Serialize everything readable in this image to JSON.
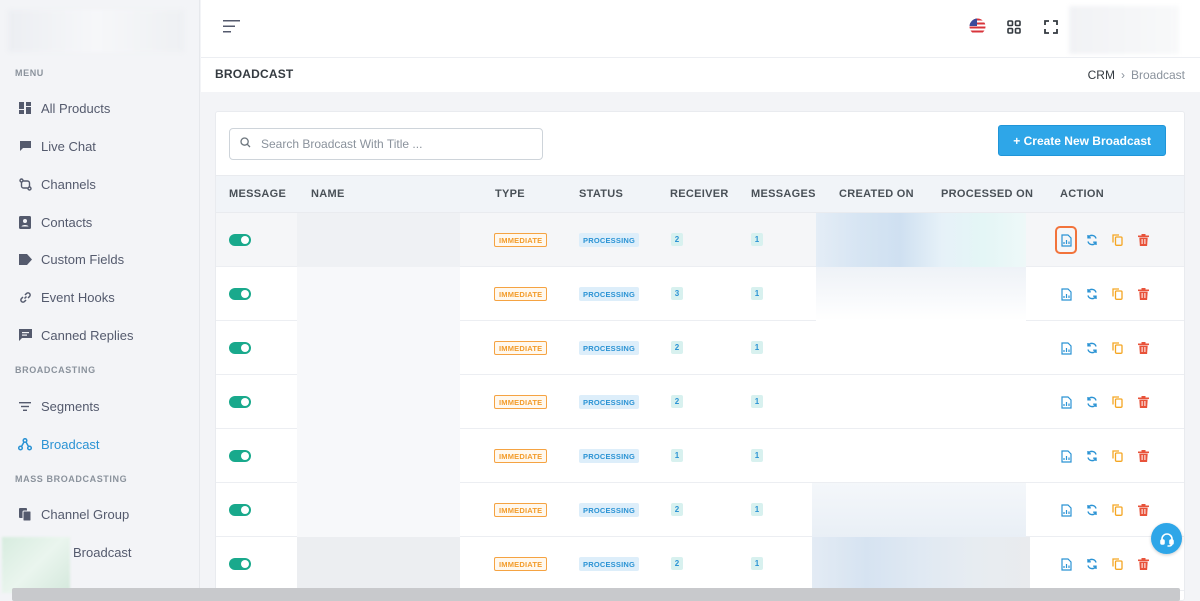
{
  "sidebar": {
    "sections": [
      {
        "title": "MENU"
      },
      {
        "title": "BROADCASTING"
      },
      {
        "title": "MASS BROADCASTING"
      }
    ],
    "items": [
      {
        "label": "All Products",
        "icon": "grid-icon"
      },
      {
        "label": "Live Chat",
        "icon": "chat-icon"
      },
      {
        "label": "Channels",
        "icon": "channels-icon"
      },
      {
        "label": "Contacts",
        "icon": "contact-card-icon"
      },
      {
        "label": "Custom Fields",
        "icon": "tag-icon"
      },
      {
        "label": "Event Hooks",
        "icon": "link-icon"
      },
      {
        "label": "Canned Replies",
        "icon": "message-icon"
      },
      {
        "label": "Segments",
        "icon": "filter-icon"
      },
      {
        "label": "Broadcast",
        "icon": "broadcast-icon",
        "active": true
      },
      {
        "label": "Channel Group",
        "icon": "copy-icon"
      },
      {
        "label": "Broadcast",
        "icon": "broadcast-icon"
      }
    ]
  },
  "page": {
    "title": "BROADCAST",
    "breadcrumb": [
      "CRM",
      "Broadcast"
    ]
  },
  "toolbar": {
    "search_placeholder": "Search Broadcast With Title ...",
    "search_value": "",
    "create_label": "+ Create New Broadcast"
  },
  "table": {
    "headers": [
      "MESSAGE",
      "NAME",
      "TYPE",
      "STATUS",
      "RECEIVER",
      "MESSAGES",
      "CREATED ON",
      "PROCESSED ON",
      "ACTION"
    ],
    "rows": [
      {
        "type": "IMMEDIATE",
        "status": "PROCESSING",
        "receiver": "2",
        "messages": "1"
      },
      {
        "type": "IMMEDIATE",
        "status": "PROCESSING",
        "receiver": "3",
        "messages": "1"
      },
      {
        "type": "IMMEDIATE",
        "status": "PROCESSING",
        "receiver": "2",
        "messages": "1"
      },
      {
        "type": "IMMEDIATE",
        "status": "PROCESSING",
        "receiver": "2",
        "messages": "1"
      },
      {
        "type": "IMMEDIATE",
        "status": "PROCESSING",
        "receiver": "1",
        "messages": "1"
      },
      {
        "type": "IMMEDIATE",
        "status": "PROCESSING",
        "receiver": "2",
        "messages": "1"
      },
      {
        "type": "IMMEDIATE",
        "status": "PROCESSING",
        "receiver": "2",
        "messages": "1"
      }
    ]
  },
  "colors": {
    "accent": "#2ea6e8",
    "toggle_on": "#19a98c",
    "type_badge": "#f39c2b",
    "delete": "#e8533a",
    "copy": "#f5a623",
    "focus_ring": "#f2733b"
  }
}
